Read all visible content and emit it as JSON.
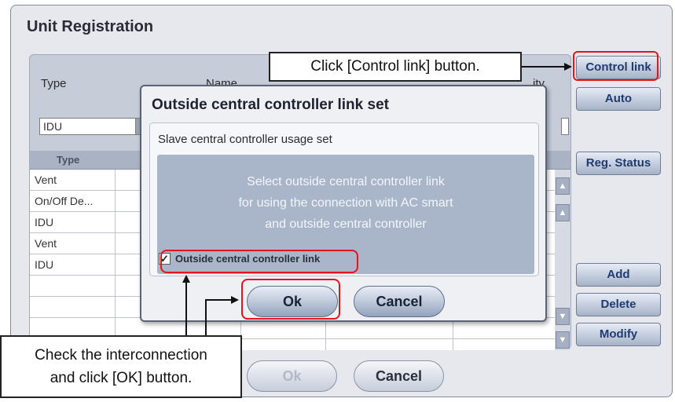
{
  "window": {
    "title": "Unit Registration"
  },
  "columns_header": {
    "type": "Type",
    "name": "Name",
    "capacity_partial": "ity"
  },
  "type_field_value": "IDU",
  "grid": {
    "header": "Type",
    "rows": [
      "Vent",
      "On/Off De...",
      "IDU",
      "Vent",
      "IDU",
      "",
      "",
      ""
    ]
  },
  "side_buttons": {
    "control_link": "Control link",
    "auto": "Auto",
    "reg_status": "Reg. Status",
    "add": "Add",
    "delete": "Delete",
    "modify": "Modify"
  },
  "bottom_buttons": {
    "ok": "Ok",
    "cancel": "Cancel"
  },
  "dialog": {
    "title": "Outside central controller link set",
    "subtitle": "Slave central controller usage set",
    "info_lines": [
      "Select outside central controller link",
      "for using the connection with AC smart",
      "and outside central controller"
    ],
    "checkbox_label": "Outside central controller link",
    "checkbox_checked": true,
    "ok": "Ok",
    "cancel": "Cancel"
  },
  "callouts": {
    "top": "Click [Control link] button.",
    "bottom_line1": "Check the interconnection",
    "bottom_line2": "and click [OK] button."
  },
  "colors": {
    "highlight": "#e3141c",
    "accent_text": "#1f3b70"
  }
}
